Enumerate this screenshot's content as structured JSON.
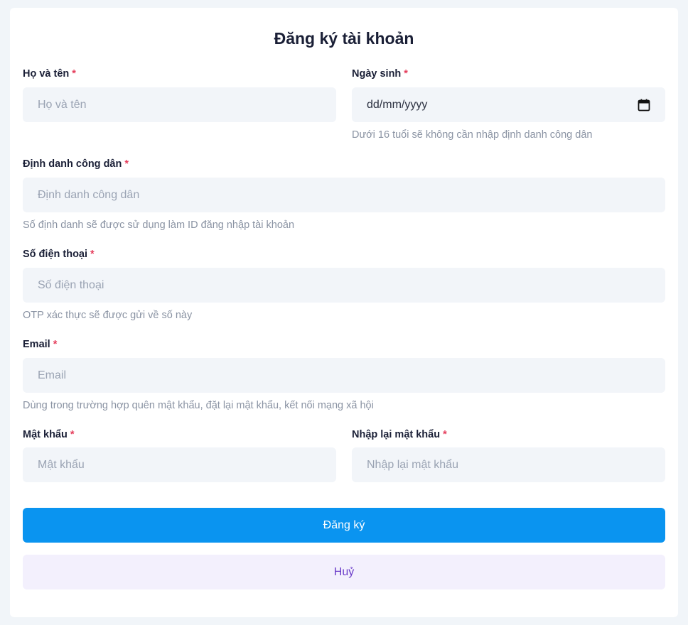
{
  "form": {
    "title": "Đăng ký tài khoản",
    "required_mark": "*",
    "full_name": {
      "label": "Họ và tên",
      "placeholder": "Họ và tên"
    },
    "dob": {
      "label": "Ngày sinh",
      "placeholder": "dd/mm/yyyy",
      "icon": "calendar-icon",
      "hint": "Dưới 16 tuổi sẽ không cần nhập định danh công dân"
    },
    "citizen_id": {
      "label": "Định danh công dân",
      "placeholder": "Định danh công dân",
      "hint": "Số định danh sẽ được sử dụng làm ID đăng nhập tài khoản"
    },
    "phone": {
      "label": "Số điện thoại",
      "placeholder": "Số điện thoại",
      "hint": "OTP xác thực sẽ được gửi về số này"
    },
    "email": {
      "label": "Email",
      "placeholder": "Email",
      "hint": "Dùng trong trường hợp quên mật khẩu, đặt lại mật khẩu, kết nối mạng xã hội"
    },
    "password": {
      "label": "Mật khẩu",
      "placeholder": "Mật khẩu"
    },
    "confirm_password": {
      "label": "Nhập lại mật khẩu",
      "placeholder": "Nhập lại mật khẩu"
    },
    "submit_label": "Đăng ký",
    "cancel_label": "Huỷ"
  },
  "colors": {
    "primary": "#0a94f0",
    "required": "#e53e5c",
    "cancel_bg": "#f3f0fd",
    "cancel_text": "#6a3bc8",
    "input_bg": "#f2f5f9"
  }
}
